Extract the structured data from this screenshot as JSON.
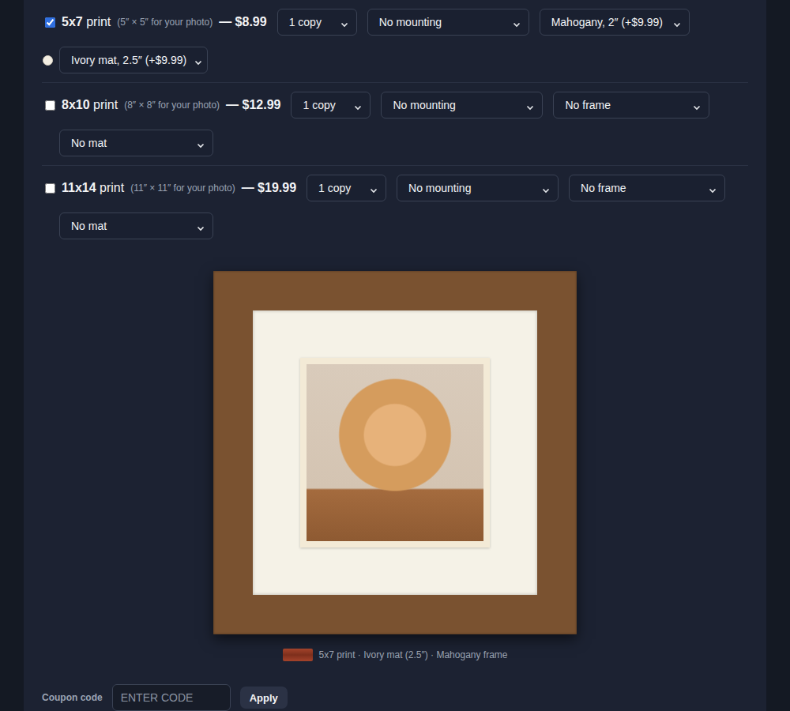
{
  "options": [
    {
      "checked": true,
      "size": "5x7",
      "suffix": "print",
      "note": "(5″ × 5″ for your photo)",
      "price": "— $8.99",
      "quantity": "1 copy",
      "mounting": "No mounting",
      "frame": "Mahogany, 2″ (+$9.99)",
      "mat": "Ivory mat, 2.5″ (+$9.99)",
      "mat_swatch": "#f3eee2"
    },
    {
      "checked": false,
      "size": "8x10",
      "suffix": "print",
      "note": "(8″ × 8″ for your photo)",
      "price": "— $12.99",
      "quantity": "1 copy",
      "mounting": "No mounting",
      "frame": "No frame",
      "mat": "No mat",
      "mat_swatch": null
    },
    {
      "checked": false,
      "size": "11x14",
      "suffix": "print",
      "note": "(11″ × 11″ for your photo)",
      "price": "— $19.99",
      "quantity": "1 copy",
      "mounting": "No mounting",
      "frame": "No frame",
      "mat": "No mat",
      "mat_swatch": null
    }
  ],
  "preview": {
    "frame_color": "#7a5230",
    "mat_color": "#f5f2e7",
    "swatch_color": "#a4432b",
    "caption": "5x7 print · Ivory mat (2.5″) · Mahogany frame"
  },
  "coupon": {
    "label": "Coupon code",
    "placeholder": "ENTER CODE",
    "button": "Apply"
  }
}
